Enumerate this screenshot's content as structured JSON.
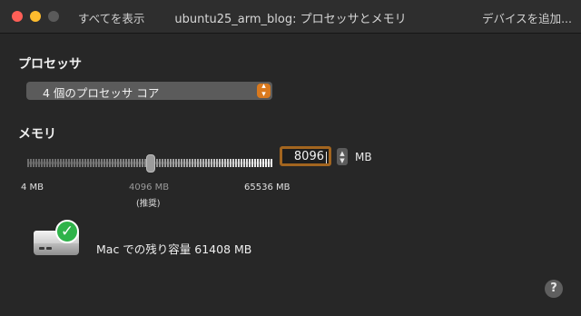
{
  "window": {
    "title": "ubuntu25_arm_blog: プロセッサとメモリ",
    "show_all": "すべてを表示",
    "add_device": "デバイスを追加..."
  },
  "processor": {
    "heading": "プロセッサ",
    "selected": "4 個のプロセッサ コア",
    "icon": "chevron-up-down-icon",
    "accent": "#d9791e"
  },
  "memory": {
    "heading": "メモリ",
    "slider_value_mb": 4096,
    "labels": {
      "min": "4 MB",
      "recommended": "4096 MB",
      "recommended_note": "(推奨)",
      "max": "65536 MB"
    },
    "input_value": "8096",
    "unit": "MB"
  },
  "storage": {
    "free_text": "Mac での残り容量 61408 MB",
    "badge_color": "#2fb34a"
  },
  "help": {
    "label": "?"
  }
}
